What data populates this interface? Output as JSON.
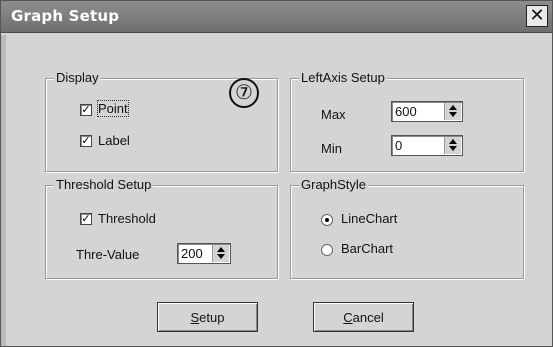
{
  "window": {
    "title": "Graph Setup",
    "close_label": "✕"
  },
  "annotation_mark": "⑦",
  "display": {
    "legend": "Display",
    "point": {
      "label": "Point",
      "checked": true
    },
    "label": {
      "label": "Label",
      "checked": true
    }
  },
  "left_axis": {
    "legend": "LeftAxis Setup",
    "max_label": "Max",
    "max_value": "600",
    "min_label": "Min",
    "min_value": "0"
  },
  "threshold": {
    "legend": "Threshold Setup",
    "threshold": {
      "label": "Threshold",
      "checked": true
    },
    "value_label": "Thre-Value",
    "value": "200"
  },
  "graph_style": {
    "legend": "GraphStyle",
    "line": {
      "label": "LineChart",
      "selected": true
    },
    "bar": {
      "label": "BarChart",
      "selected": false
    }
  },
  "buttons": {
    "setup": {
      "mnemonic": "S",
      "rest": "etup"
    },
    "cancel": {
      "mnemonic": "C",
      "rest": "ancel"
    }
  },
  "check_glyph": "✓"
}
